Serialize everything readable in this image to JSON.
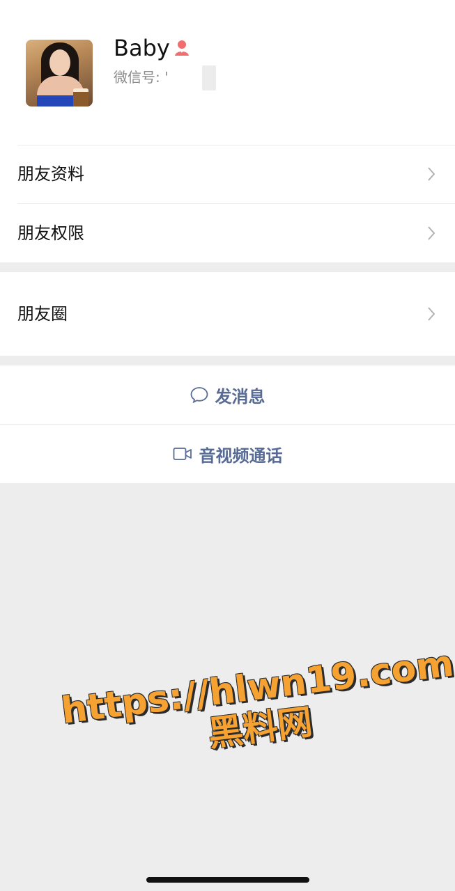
{
  "profile": {
    "name": "Baby",
    "wechat_id_label": "微信号: '",
    "gender_icon": "female-person-icon",
    "gender_color": "#f26d6d"
  },
  "menu": {
    "friend_info": "朋友资料",
    "friend_permissions": "朋友权限",
    "moments": "朋友圈"
  },
  "actions": {
    "message_label": "发消息",
    "message_icon": "chat-bubble-icon",
    "call_label": "音视频通话",
    "call_icon": "video-camera-icon",
    "accent": "#576b95"
  },
  "watermark": {
    "line1": "https://hlwn19.com",
    "line2": "黑料网",
    "color": "#f6a233"
  }
}
